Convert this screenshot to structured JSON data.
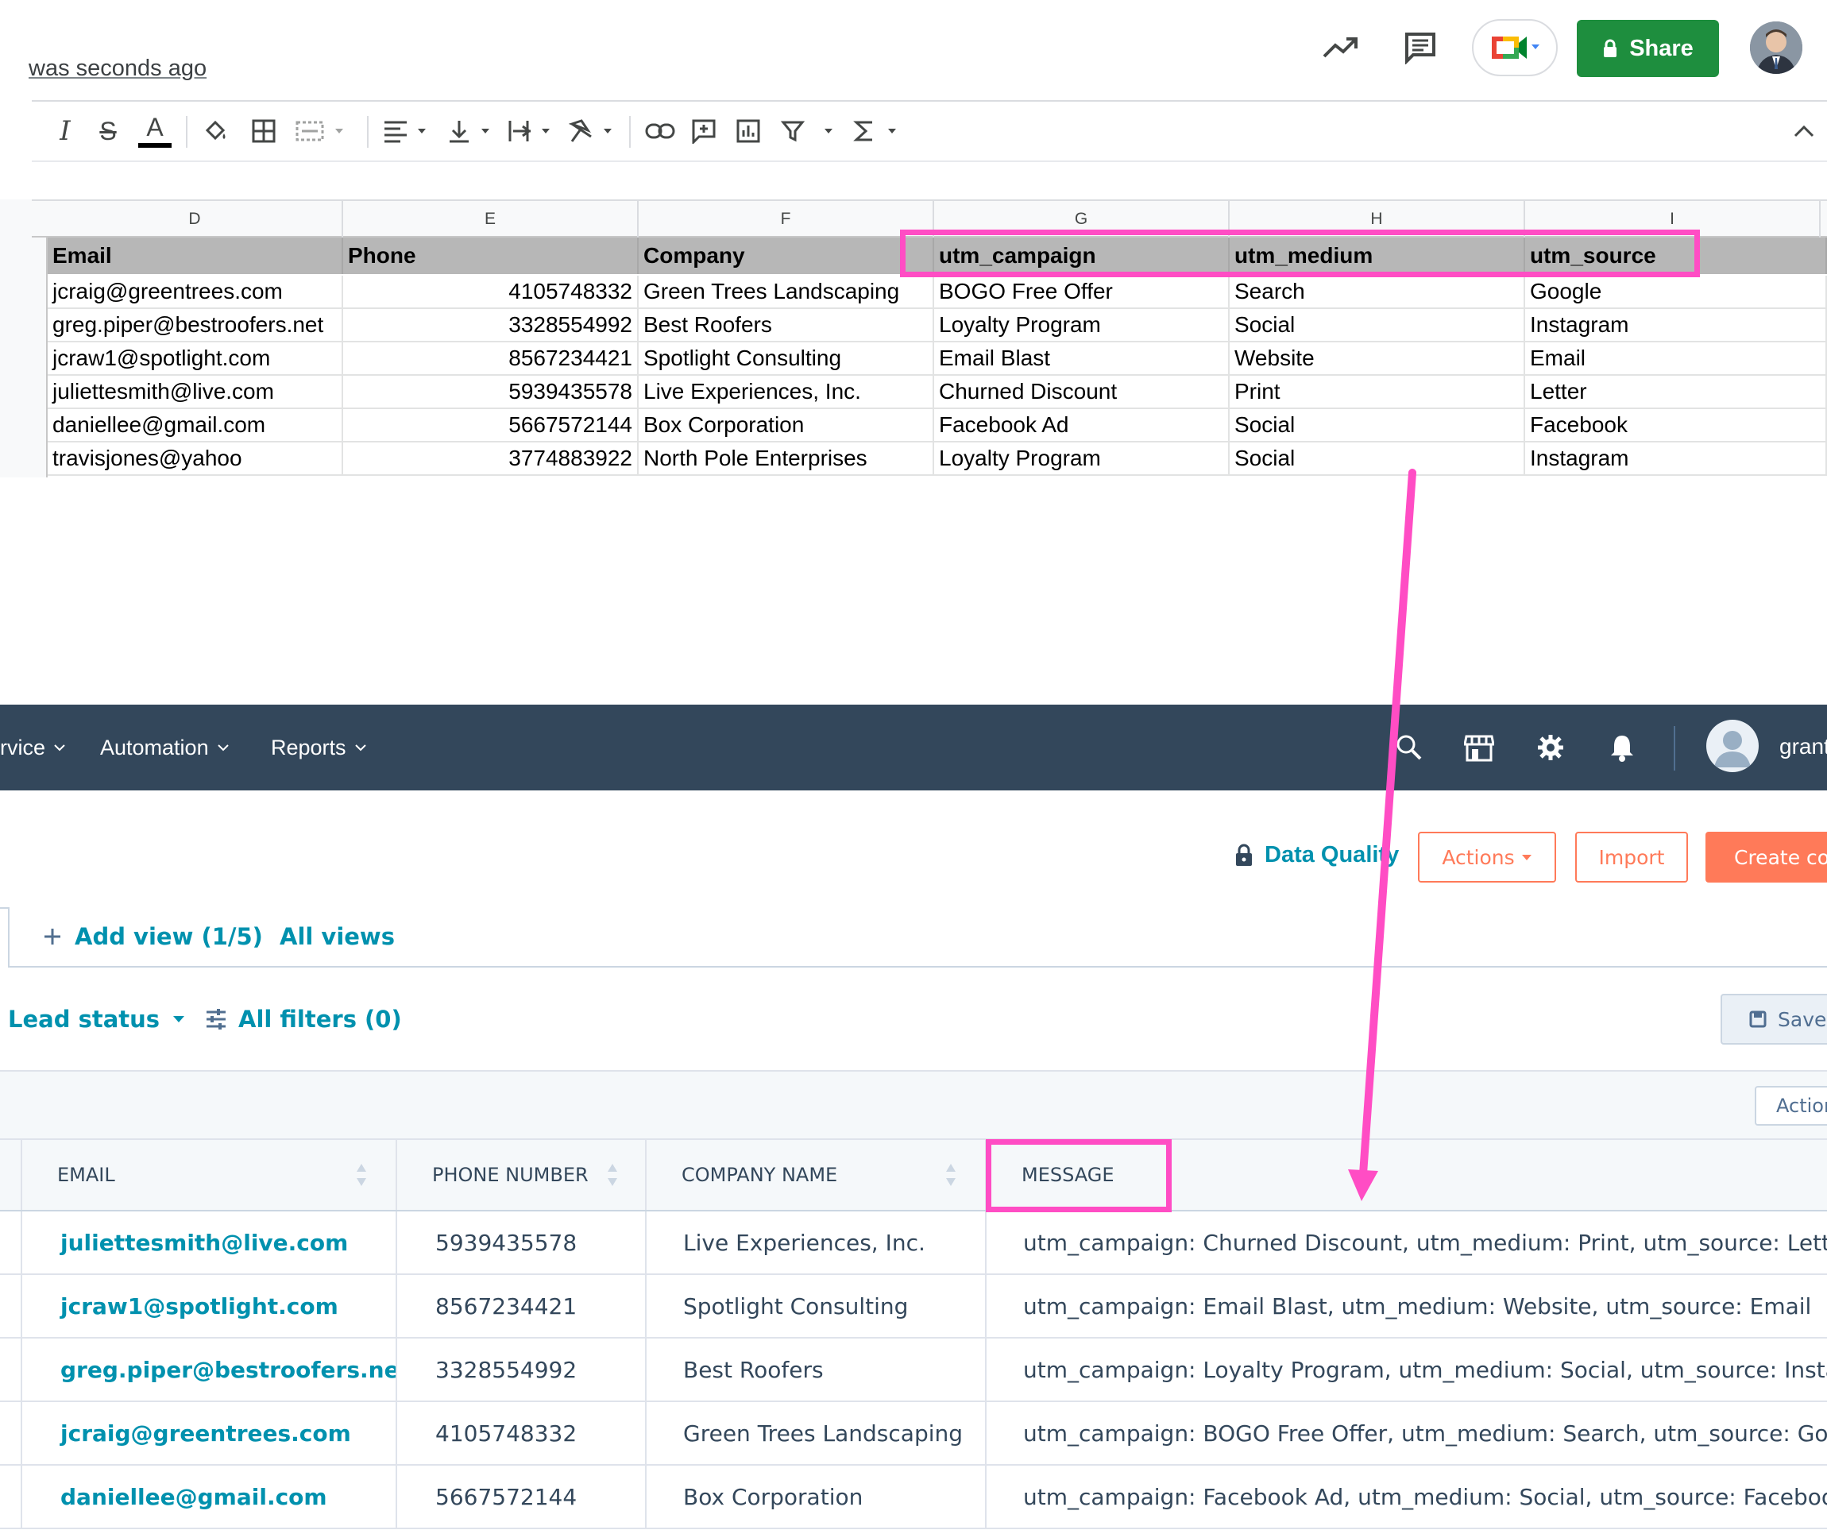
{
  "sheets": {
    "last_edit": "was seconds ago",
    "share_label": "Share",
    "toolbar_icons": [
      "italic-icon",
      "strikethrough-icon",
      "text-color-icon",
      "fill-color-icon",
      "borders-icon",
      "merge-cells-icon",
      "horizontal-align-icon",
      "vertical-align-icon",
      "text-wrapping-icon",
      "text-rotation-icon",
      "insert-link-icon",
      "insert-comment-icon",
      "insert-chart-icon",
      "filter-icon",
      "functions-icon"
    ],
    "column_letters": [
      "D",
      "E",
      "F",
      "G",
      "H",
      "I"
    ],
    "header_row": [
      "Email",
      "Phone",
      "Company",
      "utm_campaign",
      "utm_medium",
      "utm_source"
    ],
    "rows": [
      [
        "jcraig@greentrees.com",
        "4105748332",
        "Green Trees Landscaping",
        "BOGO Free Offer",
        "Search",
        "Google"
      ],
      [
        "greg.piper@bestroofers.net",
        "3328554992",
        "Best Roofers",
        "Loyalty Program",
        "Social",
        "Instagram"
      ],
      [
        "jcraw1@spotlight.com",
        "8567234421",
        "Spotlight Consulting",
        "Email Blast",
        "Website",
        "Email"
      ],
      [
        "juliettesmith@live.com",
        "5939435578",
        "Live Experiences, Inc.",
        "Churned Discount",
        "Print",
        "Letter"
      ],
      [
        "daniellee@gmail.com",
        "5667572144",
        "Box Corporation",
        "Facebook Ad",
        "Social",
        "Facebook"
      ],
      [
        "travisjones@yahoo",
        "3774883922",
        "North Pole Enterprises",
        "Loyalty Program",
        "Social",
        "Instagram"
      ]
    ]
  },
  "hubspot": {
    "nav": {
      "service": "rvice",
      "automation": "Automation",
      "reports": "Reports",
      "user_name": "grant"
    },
    "data_quality": "Data Quality",
    "actions_label": "Actions",
    "import_label": "Import",
    "create_label": "Create con",
    "add_view": "Add view (1/5)",
    "all_views": "All views",
    "lead_status": "Lead status",
    "all_filters": "All filters (0)",
    "save_view": "Save v",
    "table_actions": "Action",
    "columns": [
      "EMAIL",
      "PHONE NUMBER",
      "COMPANY NAME",
      "MESSAGE"
    ],
    "rows": [
      {
        "email": "juliettesmith@live.com",
        "phone": "5939435578",
        "company": "Live Experiences, Inc.",
        "message": "utm_campaign: Churned Discount, utm_medium: Print, utm_source: Letter"
      },
      {
        "email": "jcraw1@spotlight.com",
        "phone": "8567234421",
        "company": "Spotlight Consulting",
        "message": "utm_campaign: Email Blast, utm_medium: Website, utm_source: Email"
      },
      {
        "email": "greg.piper@bestroofers.net",
        "phone": "3328554992",
        "company": "Best Roofers",
        "message": "utm_campaign: Loyalty Program, utm_medium: Social, utm_source: Instagram"
      },
      {
        "email": "jcraig@greentrees.com",
        "phone": "4105748332",
        "company": "Green Trees Landscaping",
        "message": "utm_campaign: BOGO Free Offer, utm_medium: Search, utm_source: Google"
      },
      {
        "email": "daniellee@gmail.com",
        "phone": "5667572144",
        "company": "Box Corporation",
        "message": "utm_campaign: Facebook Ad, utm_medium: Social, utm_source: Facebook"
      }
    ]
  },
  "colors": {
    "annotation_pink": "#ff4dc4",
    "sheets_green": "#1e8e3e",
    "hubspot_nav": "#33475b",
    "hubspot_link": "#0091ae",
    "hubspot_orange": "#ff7a59"
  }
}
